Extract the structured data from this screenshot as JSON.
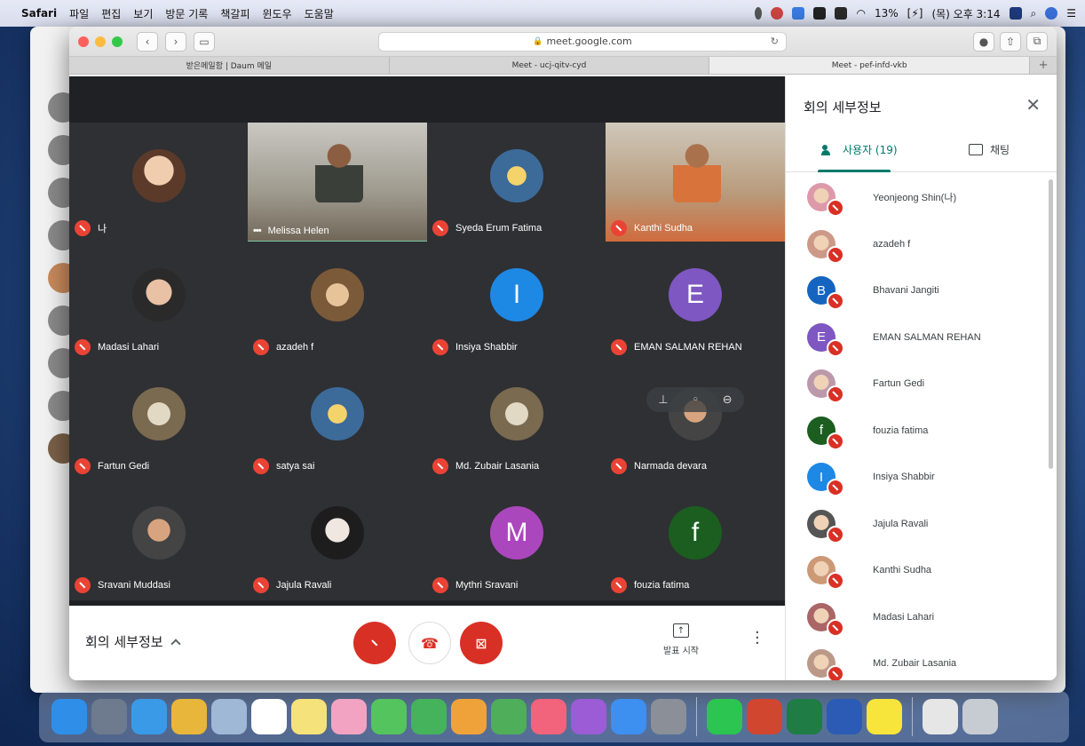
{
  "menubar": {
    "app": "Safari",
    "items": [
      "파일",
      "편집",
      "보기",
      "방문 기록",
      "책갈피",
      "윈도우",
      "도움말"
    ],
    "battery": "13%",
    "clock": "(목) 오후 3:14"
  },
  "browser": {
    "url": "meet.google.com",
    "tabs": [
      "받은메일함 | Daum 메일",
      "Meet - ucj-qitv-cyd",
      "Meet - pef-infd-vkb"
    ]
  },
  "meet": {
    "tiles": [
      {
        "name": "나",
        "kind": "photo"
      },
      {
        "name": "Melissa Helen",
        "kind": "video-a",
        "speaking": true
      },
      {
        "name": "Syeda Erum Fatima",
        "kind": "photo4"
      },
      {
        "name": "Kanthi Sudha",
        "kind": "video-b"
      },
      {
        "name": "Madasi Lahari",
        "kind": "photo2"
      },
      {
        "name": "azadeh f",
        "kind": "photo3"
      },
      {
        "name": "Insiya Shabbir",
        "kind": "letter",
        "letter": "I",
        "color": "#1e88e5"
      },
      {
        "name": "EMAN SALMAN REHAN",
        "kind": "letter",
        "letter": "E",
        "color": "#7e57c2"
      },
      {
        "name": "Fartun Gedi",
        "kind": "photo5"
      },
      {
        "name": "satya sai",
        "kind": "photo4"
      },
      {
        "name": "Md. Zubair Lasania",
        "kind": "photo5"
      },
      {
        "name": "Narmada devara",
        "kind": "photo6",
        "hover": true
      },
      {
        "name": "Sravani Muddasi",
        "kind": "photo6"
      },
      {
        "name": "Jajula Ravali",
        "kind": "photo7"
      },
      {
        "name": "Mythri Sravani",
        "kind": "letter",
        "letter": "M",
        "color": "#ab47bc"
      },
      {
        "name": "fouzia fatima",
        "kind": "letter",
        "letter": "f",
        "color": "#1b5e20"
      }
    ],
    "bottom": {
      "details_label": "회의 세부정보",
      "present_label": "발표 시작"
    },
    "panel": {
      "title": "회의 세부정보",
      "users_tab": "사용자 (19)",
      "chat_tab": "채팅",
      "participants": [
        {
          "name": "Yeonjeong Shin(나)",
          "kind": "photo",
          "color": "#d9a"
        },
        {
          "name": "azadeh f",
          "kind": "photo",
          "color": "#c98"
        },
        {
          "name": "Bhavani Jangiti",
          "kind": "letter",
          "letter": "B",
          "color": "#1565c0"
        },
        {
          "name": "EMAN SALMAN REHAN",
          "kind": "letter",
          "letter": "E",
          "color": "#7e57c2"
        },
        {
          "name": "Fartun Gedi",
          "kind": "photo",
          "color": "#b9a"
        },
        {
          "name": "fouzia fatima",
          "kind": "letter",
          "letter": "f",
          "color": "#1b5e20"
        },
        {
          "name": "Insiya Shabbir",
          "kind": "letter",
          "letter": "I",
          "color": "#1e88e5"
        },
        {
          "name": "Jajula Ravali",
          "kind": "photo",
          "color": "#555"
        },
        {
          "name": "Kanthi Sudha",
          "kind": "photo",
          "color": "#c97"
        },
        {
          "name": "Madasi Lahari",
          "kind": "photo",
          "color": "#a66"
        },
        {
          "name": "Md. Zubair Lasania",
          "kind": "photo",
          "color": "#b98"
        }
      ]
    }
  },
  "colors": {
    "accent_teal": "#00796b",
    "mute_red": "#ea4335",
    "stage_bg": "#202124"
  }
}
